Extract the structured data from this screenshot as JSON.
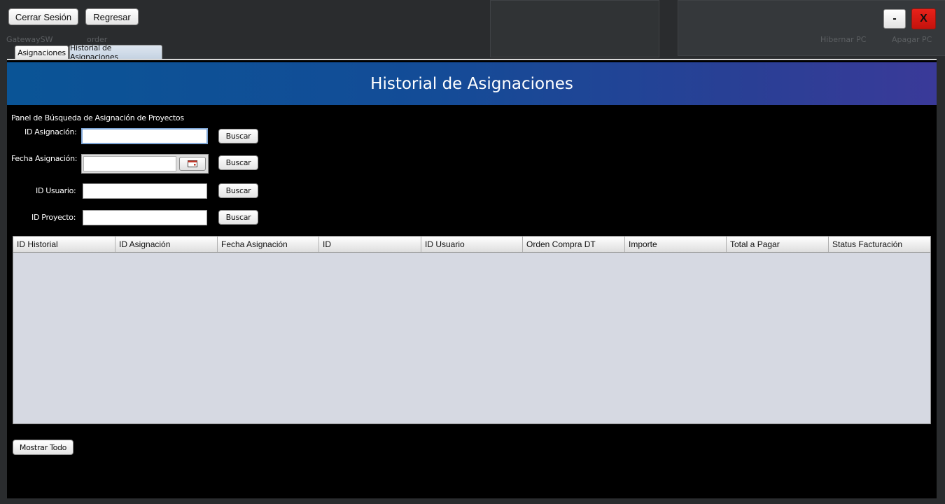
{
  "desktop": {
    "icon_labels": [
      "GatewaySW",
      "order",
      "Hibernar PC",
      "Apagar PC"
    ]
  },
  "toolbar": {
    "logout_label": "Cerrar Sesión",
    "back_label": "Regresar"
  },
  "window_controls": {
    "minimize_label": "-",
    "close_label": "X"
  },
  "tabs": [
    {
      "label": "Asignaciones",
      "active": false
    },
    {
      "label": "Historial de Asignaciones",
      "active": true
    }
  ],
  "header": {
    "title": "Historial de Asignaciones"
  },
  "search_panel": {
    "title": "Panel de Búsqueda de Asignación de Proyectos",
    "fields": [
      {
        "label": "ID Asignación:",
        "value": "",
        "button": "Buscar"
      },
      {
        "label": "Fecha Asignación:",
        "value": "",
        "button": "Buscar"
      },
      {
        "label": "ID Usuario:",
        "value": "",
        "button": "Buscar"
      },
      {
        "label": "ID Proyecto:",
        "value": "",
        "button": "Buscar"
      }
    ]
  },
  "table": {
    "columns": [
      "ID Historial",
      "ID Asignación",
      "Fecha Asignación",
      "ID",
      "ID Usuario",
      "Orden Compra DT",
      "Importe",
      "Total a Pagar",
      "Status Facturación"
    ],
    "rows": []
  },
  "footer": {
    "show_all_label": "Mostrar Todo"
  },
  "colors": {
    "header_start": "#0a5496",
    "header_end": "#3a3a99",
    "close_button": "#d8190f",
    "table_body": "#d6d9e2"
  }
}
